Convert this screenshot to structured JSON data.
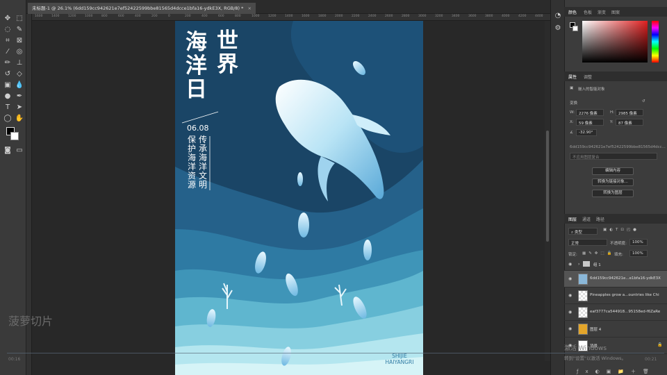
{
  "document_tab": {
    "label": "未标题-1 @ 26.1% (6dd159cc942621e7ef52422599bbe81565d4dcce1bfa16-ydkE3X, RGB/8) *",
    "close": "×"
  },
  "ruler_ticks": [
    "1600",
    "1400",
    "1200",
    "1000",
    "800",
    "600",
    "400",
    "200",
    "0",
    "200",
    "400",
    "600",
    "800",
    "1000",
    "1200",
    "1400",
    "1600",
    "1800",
    "2000",
    "2200",
    "2400",
    "2600",
    "2800",
    "3000",
    "3200",
    "3400",
    "3600",
    "3800",
    "4000",
    "4200",
    "4400"
  ],
  "poster": {
    "title_left": [
      "海",
      "洋",
      "日"
    ],
    "title_right": [
      "世",
      "界"
    ],
    "date": "06.08",
    "col1": [
      "保",
      "护",
      "海",
      "洋",
      "资",
      "源"
    ],
    "col2": [
      "传",
      "承",
      "海",
      "洋",
      "文",
      "明"
    ],
    "footer_line1": "SHIJIE",
    "footer_line2": "HAIYANGRI"
  },
  "color_panel": {
    "tabs": [
      "颜色",
      "色板",
      "渐变",
      "图案"
    ]
  },
  "properties_panel": {
    "tabs": [
      "属性",
      "调整"
    ],
    "object_type": "嵌入的智能对象",
    "section_transform": "变换",
    "w_label": "W:",
    "w_value": "2276 像素",
    "h_label": "H:",
    "h_value": "2985 像素",
    "x_label": "X:",
    "x_value": "59 像素",
    "y_label": "Y:",
    "y_value": "87 像素",
    "angle_value": "-32.90°",
    "file_name": "6dd159cc942621e7ef52422599bbe81565d4dcc...",
    "layer_comp": "不应用图层复合",
    "btn_edit": "编辑内容",
    "btn_convert_linked": "转换为链接对象...",
    "btn_convert_layers": "转换为图层"
  },
  "layers_panel": {
    "tabs": [
      "图层",
      "通道",
      "路径"
    ],
    "filter_kind": "类型",
    "blend_mode": "正常",
    "opacity_label": "不透明度:",
    "opacity_value": "100%",
    "lock_label": "锁定:",
    "fill_label": "填充:",
    "fill_value": "100%",
    "layers": [
      {
        "name": "组 1",
        "type": "group"
      },
      {
        "name": "6dd159cc942621e...e1bfa16-ydkE3X",
        "type": "smart",
        "selected": true
      },
      {
        "name": "Pineapples grow a...ountries like Chi",
        "type": "raster"
      },
      {
        "name": "eaf3777ca544918...95158ed-f6ZaRe",
        "type": "raster"
      },
      {
        "name": "图层 4",
        "type": "raster"
      },
      {
        "name": "背景",
        "type": "background"
      }
    ]
  },
  "overlay": {
    "watermark": "菠萝切片",
    "time_left": "00:16",
    "time_right": "00:21",
    "activate_line1": "激活 Windows",
    "activate_line2": "转到\"设置\"以激活 Windows。"
  },
  "colors": {
    "poster_deep": "#1d4d6f",
    "poster_mid": "#2e7aa3",
    "poster_light": "#7fd0e0",
    "poster_pale": "#c9f0f5",
    "accent_red": "#e02020"
  }
}
